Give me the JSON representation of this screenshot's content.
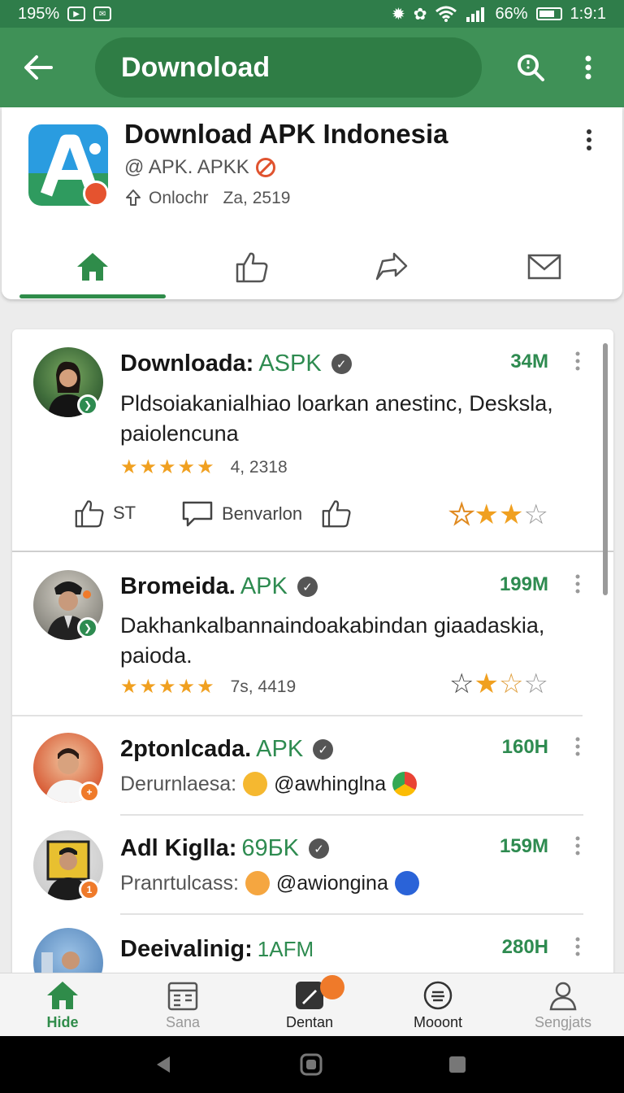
{
  "status_bar": {
    "left_text": "195%",
    "right_battery": "66%",
    "time": "1:9:1",
    "icons": [
      "notification-icon",
      "message-icon",
      "bug-icon",
      "settings-icon",
      "wifi-icon",
      "signal-icon",
      "battery-icon"
    ]
  },
  "app_bar": {
    "title": "Downoload",
    "back_icon": "arrow-left-icon",
    "search_icon": "search-icon",
    "more_icon": "more-vertical-icon",
    "color": "#3f9157"
  },
  "header": {
    "title": "Download APK Indonesia",
    "handle": "@ APK. APKK",
    "meta_label": "Onlochr",
    "meta_count": "Za, 2519",
    "tabs": [
      {
        "name": "home",
        "icon": "home-icon",
        "active": true
      },
      {
        "name": "likes",
        "icon": "thumbs-up-icon",
        "active": false
      },
      {
        "name": "share",
        "icon": "share-icon",
        "active": false
      },
      {
        "name": "messages",
        "icon": "mail-icon",
        "active": false
      }
    ]
  },
  "posts": [
    {
      "name": "Downloada:",
      "tag": "ASPK",
      "count": "34M",
      "description": "Pldsoiakanialhiao loarkan anestinc, Deskslа, paiolencuna",
      "star_count": 5,
      "rating_text": "4, 2318",
      "actions": {
        "like_label": "ST",
        "comment_label": "Benvarlon"
      },
      "rate": 3
    },
    {
      "name": "Bromeida.",
      "tag": "APK",
      "count": "199M",
      "description": "Dakhankalbannaindoakabindan giaadaskia, paioda.",
      "star_count": 5,
      "rating_text": "7s, 4419",
      "rate": 1.5
    },
    {
      "name": "2ptonlcada.",
      "tag": "APK",
      "count": "160H",
      "sub_label": "Derurnlaesa:",
      "sub_handle": "@awhinglna"
    },
    {
      "name": "Adl Kiglla:",
      "tag": "69БK",
      "count": "159M",
      "sub_label": "Pranrtulcass:",
      "sub_handle": "@awiongina"
    },
    {
      "name": "Deeivalinig:",
      "tag": "1AFM",
      "count": "280H"
    }
  ],
  "bottom_nav": [
    {
      "label": "Hide",
      "icon": "home-icon",
      "active": true
    },
    {
      "label": "Sana",
      "icon": "calendar-icon",
      "active": false
    },
    {
      "label": "Dentan",
      "icon": "edit-icon",
      "active": false
    },
    {
      "label": "Mooont",
      "icon": "menu-circle-icon",
      "active": false
    },
    {
      "label": "Sengjats",
      "icon": "person-icon",
      "active": false
    }
  ],
  "colors": {
    "primary": "#3f9157",
    "accent_green": "#2e8b50",
    "star": "#f0a020",
    "notification": "#ef7a2a"
  }
}
